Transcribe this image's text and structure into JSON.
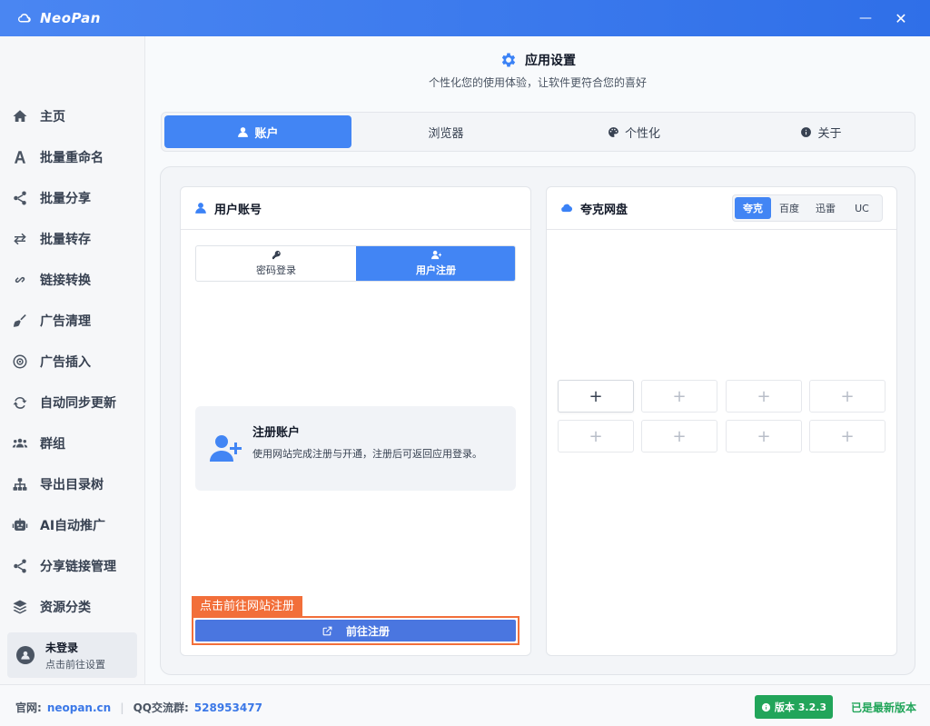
{
  "app": {
    "title": "NeoPan"
  },
  "window": {
    "minimize_label": "—",
    "close_label": "✕"
  },
  "sidebar": {
    "items": [
      {
        "label": "主页",
        "icon": "home-icon"
      },
      {
        "label": "批量重命名",
        "icon": "font-icon"
      },
      {
        "label": "批量分享",
        "icon": "share-icon"
      },
      {
        "label": "批量转存",
        "icon": "exchange-icon"
      },
      {
        "label": "链接转换",
        "icon": "link-icon"
      },
      {
        "label": "广告清理",
        "icon": "broom-icon"
      },
      {
        "label": "广告插入",
        "icon": "target-icon"
      },
      {
        "label": "自动同步更新",
        "icon": "sync-icon"
      },
      {
        "label": "群组",
        "icon": "users-icon"
      },
      {
        "label": "导出目录树",
        "icon": "sitemap-icon"
      },
      {
        "label": "AI自动推广",
        "icon": "robot-icon"
      },
      {
        "label": "分享链接管理",
        "icon": "share-icon"
      },
      {
        "label": "资源分类",
        "icon": "layers-icon"
      }
    ],
    "user": {
      "name": "未登录",
      "hint": "点击前往设置"
    }
  },
  "header": {
    "title": "应用设置",
    "subtitle": "个性化您的使用体验，让软件更符合您的喜好"
  },
  "tabs": [
    {
      "label": "账户",
      "icon": "user-icon",
      "active": true
    },
    {
      "label": "浏览器",
      "icon": "",
      "active": false
    },
    {
      "label": "个性化",
      "icon": "palette-icon",
      "active": false
    },
    {
      "label": "关于",
      "icon": "info-icon",
      "active": false
    }
  ],
  "account_card": {
    "title": "用户账号",
    "segments": [
      {
        "label": "密码登录",
        "icon": "key-icon",
        "active": false
      },
      {
        "label": "用户注册",
        "icon": "user-plus-icon",
        "active": true
      }
    ],
    "register": {
      "title": "注册账户",
      "description": "使用网站完成注册与开通，注册后可返回应用登录。"
    },
    "tip_label": "点击前往网站注册",
    "go_button": "前往注册"
  },
  "disk_card": {
    "title": "夸克网盘",
    "providers": [
      {
        "label": "夸克",
        "active": true
      },
      {
        "label": "百度",
        "active": false
      },
      {
        "label": "迅雷",
        "active": false
      },
      {
        "label": "UC",
        "active": false
      }
    ],
    "slots": [
      "+",
      "+",
      "+",
      "+",
      "+",
      "+",
      "+",
      "+"
    ]
  },
  "footer": {
    "site_label": "官网:",
    "site_link": "neopan.cn",
    "qq_label": "QQ交流群:",
    "qq_number": "528953477",
    "version": "版本 3.2.3",
    "version_status": "已是最新版本"
  },
  "colors": {
    "accent": "#4285f4",
    "titlebar": "#3b7aef",
    "highlight": "#f26f3a",
    "success": "#22a55a"
  }
}
